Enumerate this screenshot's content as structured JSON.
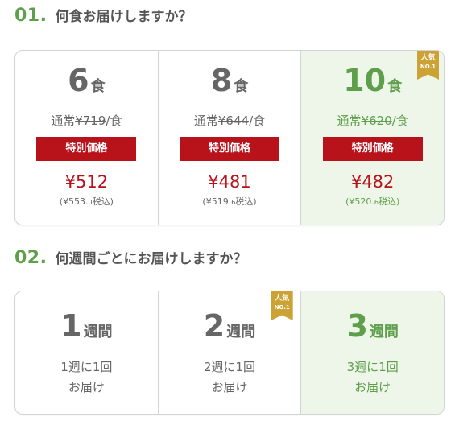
{
  "section1": {
    "step": "01.",
    "title": "何食お届けしますか？",
    "options": [
      {
        "count": "6",
        "unit": "食",
        "normal_prefix": "通常",
        "normal_price": "¥719",
        "normal_suffix": "/食",
        "special_label": "特別価格",
        "sale_price": "¥512",
        "tax_price": "(¥553.",
        "tax_decimal": "0",
        "tax_suffix": "税込)"
      },
      {
        "count": "8",
        "unit": "食",
        "normal_prefix": "通常",
        "normal_price": "¥644",
        "normal_suffix": "/食",
        "special_label": "特別価格",
        "sale_price": "¥481",
        "tax_price": "(¥519.",
        "tax_decimal": "6",
        "tax_suffix": "税込)"
      },
      {
        "count": "10",
        "unit": "食",
        "normal_prefix": "通常",
        "normal_price": "¥620",
        "normal_suffix": "/食",
        "special_label": "特別価格",
        "sale_price": "¥482",
        "tax_price": "(¥520.",
        "tax_decimal": "6",
        "tax_suffix": "税込)",
        "selected": true,
        "badge": {
          "line1": "人気",
          "line2": "NO.1"
        }
      }
    ]
  },
  "section2": {
    "step": "02.",
    "title": "何週間ごとにお届けしますか？",
    "options": [
      {
        "count": "1",
        "unit": "週間",
        "desc1": "1週に1回",
        "desc2": "お届け"
      },
      {
        "count": "2",
        "unit": "週間",
        "desc1": "2週に1回",
        "desc2": "お届け",
        "badge": {
          "line1": "人気",
          "line2": "NO.1"
        }
      },
      {
        "count": "3",
        "unit": "週間",
        "desc1": "3週に1回",
        "desc2": "お届け",
        "selected": true
      }
    ]
  },
  "colors": {
    "accent_green": "#5e9f4b",
    "price_red": "#b8121b",
    "badge_gold": "#cda235",
    "selected_bg": "#eef5e9"
  }
}
